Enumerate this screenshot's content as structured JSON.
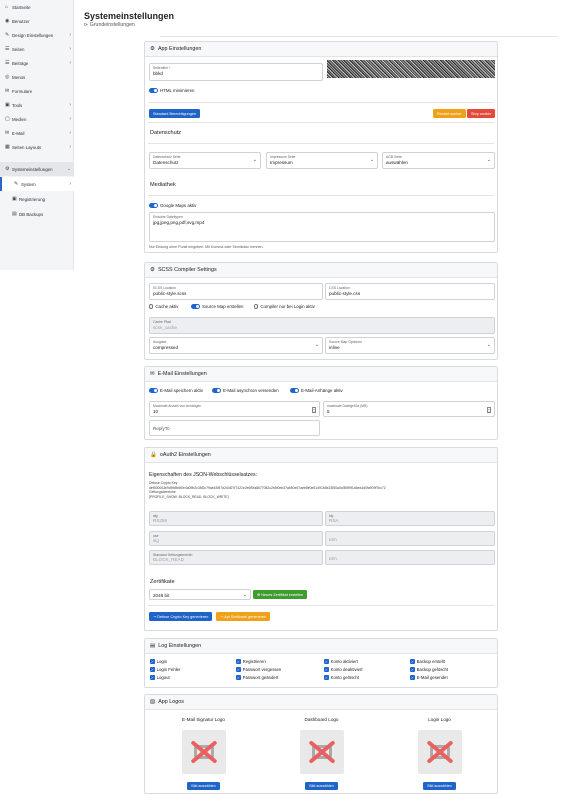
{
  "sidebar": {
    "items": [
      {
        "icon": "home-icon",
        "glyph": "⌂",
        "label": "Startseite",
        "chevron": false
      },
      {
        "icon": "user-icon",
        "glyph": "👤",
        "label": "Benutzer",
        "chevron": false
      },
      {
        "icon": "paint-brush-icon",
        "glyph": "✎",
        "label": "Design Einstellungen",
        "chevron": true
      },
      {
        "icon": "pages-icon",
        "glyph": "☰",
        "label": "Seiten",
        "chevron": true
      },
      {
        "icon": "posts-icon",
        "glyph": "☰",
        "label": "Beiträge",
        "chevron": true
      },
      {
        "icon": "menu-icon",
        "glyph": "◎",
        "label": "Menüs",
        "chevron": false
      },
      {
        "icon": "forms-icon",
        "glyph": "✉",
        "label": "Formulare",
        "chevron": false
      },
      {
        "icon": "tools-icon",
        "glyph": "▣",
        "label": "Tools",
        "chevron": true
      },
      {
        "icon": "media-icon",
        "glyph": "▢",
        "label": "Medien",
        "chevron": true
      },
      {
        "icon": "mail-icon",
        "glyph": "✉",
        "label": "E-Mail",
        "chevron": true
      },
      {
        "icon": "layout-icon",
        "glyph": "▦",
        "label": "Seiten Layouts",
        "chevron": true
      },
      {
        "icon": "gear-icon",
        "glyph": "⚙",
        "label": "Systemeinstellungen",
        "chevron": true,
        "active": true
      }
    ],
    "sub_items": [
      {
        "icon": "wrench-icon",
        "glyph": "✎",
        "label": "System",
        "chevron": true,
        "active": true
      },
      {
        "icon": "registration-icon",
        "glyph": "▣",
        "label": "Registrierung"
      },
      {
        "icon": "database-icon",
        "glyph": "▤",
        "label": "DB Backups"
      }
    ]
  },
  "header": {
    "title": "Systemeinstellungen",
    "breadcrumb": "Grundeinstellungen"
  },
  "app": {
    "title": "App Einstellungen",
    "seitentitel_label": "Seitentitel *",
    "seitentitel_value": "bbkd",
    "html_min_label": "HTML minimieren",
    "btn_standard": "Standard Berechtigungen",
    "btn_restart": "Restart worker",
    "btn_stop": "Stop worker"
  },
  "datenschutz": {
    "title": "Datenschutz",
    "datenschutz_label": "Datenschutz Seite",
    "datenschutz_value": "Datenschutz",
    "impressum_label": "Impressum Seite",
    "impressum_value": "Impressum",
    "agb_label": "AGB Seite",
    "agb_value": "auswählen"
  },
  "mediathek": {
    "title": "Mediathek",
    "gmaps_label": "Google Maps aktiv",
    "dateitypen_label": "Erlaubte Dateitypen",
    "dateitypen_value": "jpg,jpeg,png,pdf,svg,mp4",
    "hint": "Nur Endung ohne Punkt eingeben. Mit Komma oder Semikolon trennen."
  },
  "scss": {
    "title": "SCSS Compiler Settings",
    "scss_label": "SCSS Location",
    "scss_value": "public-style.scss",
    "css_label": "CSS Location",
    "css_value": "public-style.css",
    "cache_label": "Cache aktiv",
    "sourcemap_label": "Source Map erstellen",
    "compiler_login_label": "Compiler nur bei Login aktiv",
    "cache_pfad_label": "Cache Pfad",
    "cache_pfad_value": "scss_cache",
    "ausgabe_label": "Ausgabe",
    "ausgabe_value": "compressed",
    "sourcemap_opt_label": "Source Map Optionen",
    "sourcemap_opt_value": "inline"
  },
  "email": {
    "title": "E-Mail Einstellungen",
    "speichern_label": "E-Mail speichern aktiv",
    "asynchron_label": "E-Mail asynchron versenden",
    "anhaenge_label": "E-Mail-Anhänge aktiv",
    "max_anhaenge_label": "Maximale Anzahl von Anhängen",
    "max_anhaenge_value": "10",
    "max_groesse_label": "maximale Dateigröße (MB)",
    "max_groesse_value": "5",
    "replyto_placeholder": "ReplyTo"
  },
  "oauth": {
    "title": "oAuth2 Einstellungen",
    "subtitle": "Eigenschaften des JSON-Webschlüsselsatzes:",
    "kv_lines": [
      "Defuse Crypto Key",
      "def000003e9d9b5b6f0e4a09b2c35f2c79ae43f57d2d4f27f7421e2e6f0fa8677082c2b5f0eb37ab50e57aee8e0e51d91b8e23f50a0cf3f5f9f1a5ed4d0fa909f7bc72",
      "Geltungsbereiche",
      "[PROFILE_SHOW, BLOCK_READ, BLOCK_WRITE]"
    ],
    "fields": [
      {
        "label": "alg",
        "value": "RS256"
      },
      {
        "label": "kty",
        "value": "RSA"
      },
      {
        "label": "use",
        "value": "sig",
        "suffix": "e2n"
      },
      {
        "label": "Standard Geltungsbereich",
        "value": "BLOCK_READ",
        "suffix": "e2n"
      }
    ],
    "zertifikate_title": "Zertifikate",
    "zertifikat_value": "2048 bit",
    "btn_neues_zert": "Neues Zertifikat erstellen",
    "btn_defuse": "Defuse Crypto Key generieren",
    "btn_ssl": "Api Schlüssel generieren"
  },
  "log": {
    "title": "Log Einstellungen",
    "columns": [
      [
        "Login",
        "Login Fehler",
        "Logout"
      ],
      [
        "Registrieren",
        "Passwort vergessen",
        "Passwort geändert"
      ],
      [
        "Konto aktiviert",
        "Konto deaktiviert",
        "Konto gelöscht"
      ],
      [
        "Backup erstellt",
        "Backup gelöscht",
        "E-Mail gesendet"
      ]
    ]
  },
  "logos": {
    "title": "App Logos",
    "items": [
      {
        "title": "E-Mail Signatur Logo",
        "button": "Bild auswählen"
      },
      {
        "title": "Dashboard Logo",
        "button": "Bild auswählen"
      },
      {
        "title": "Login Logo",
        "button": "Bild auswählen"
      }
    ]
  }
}
